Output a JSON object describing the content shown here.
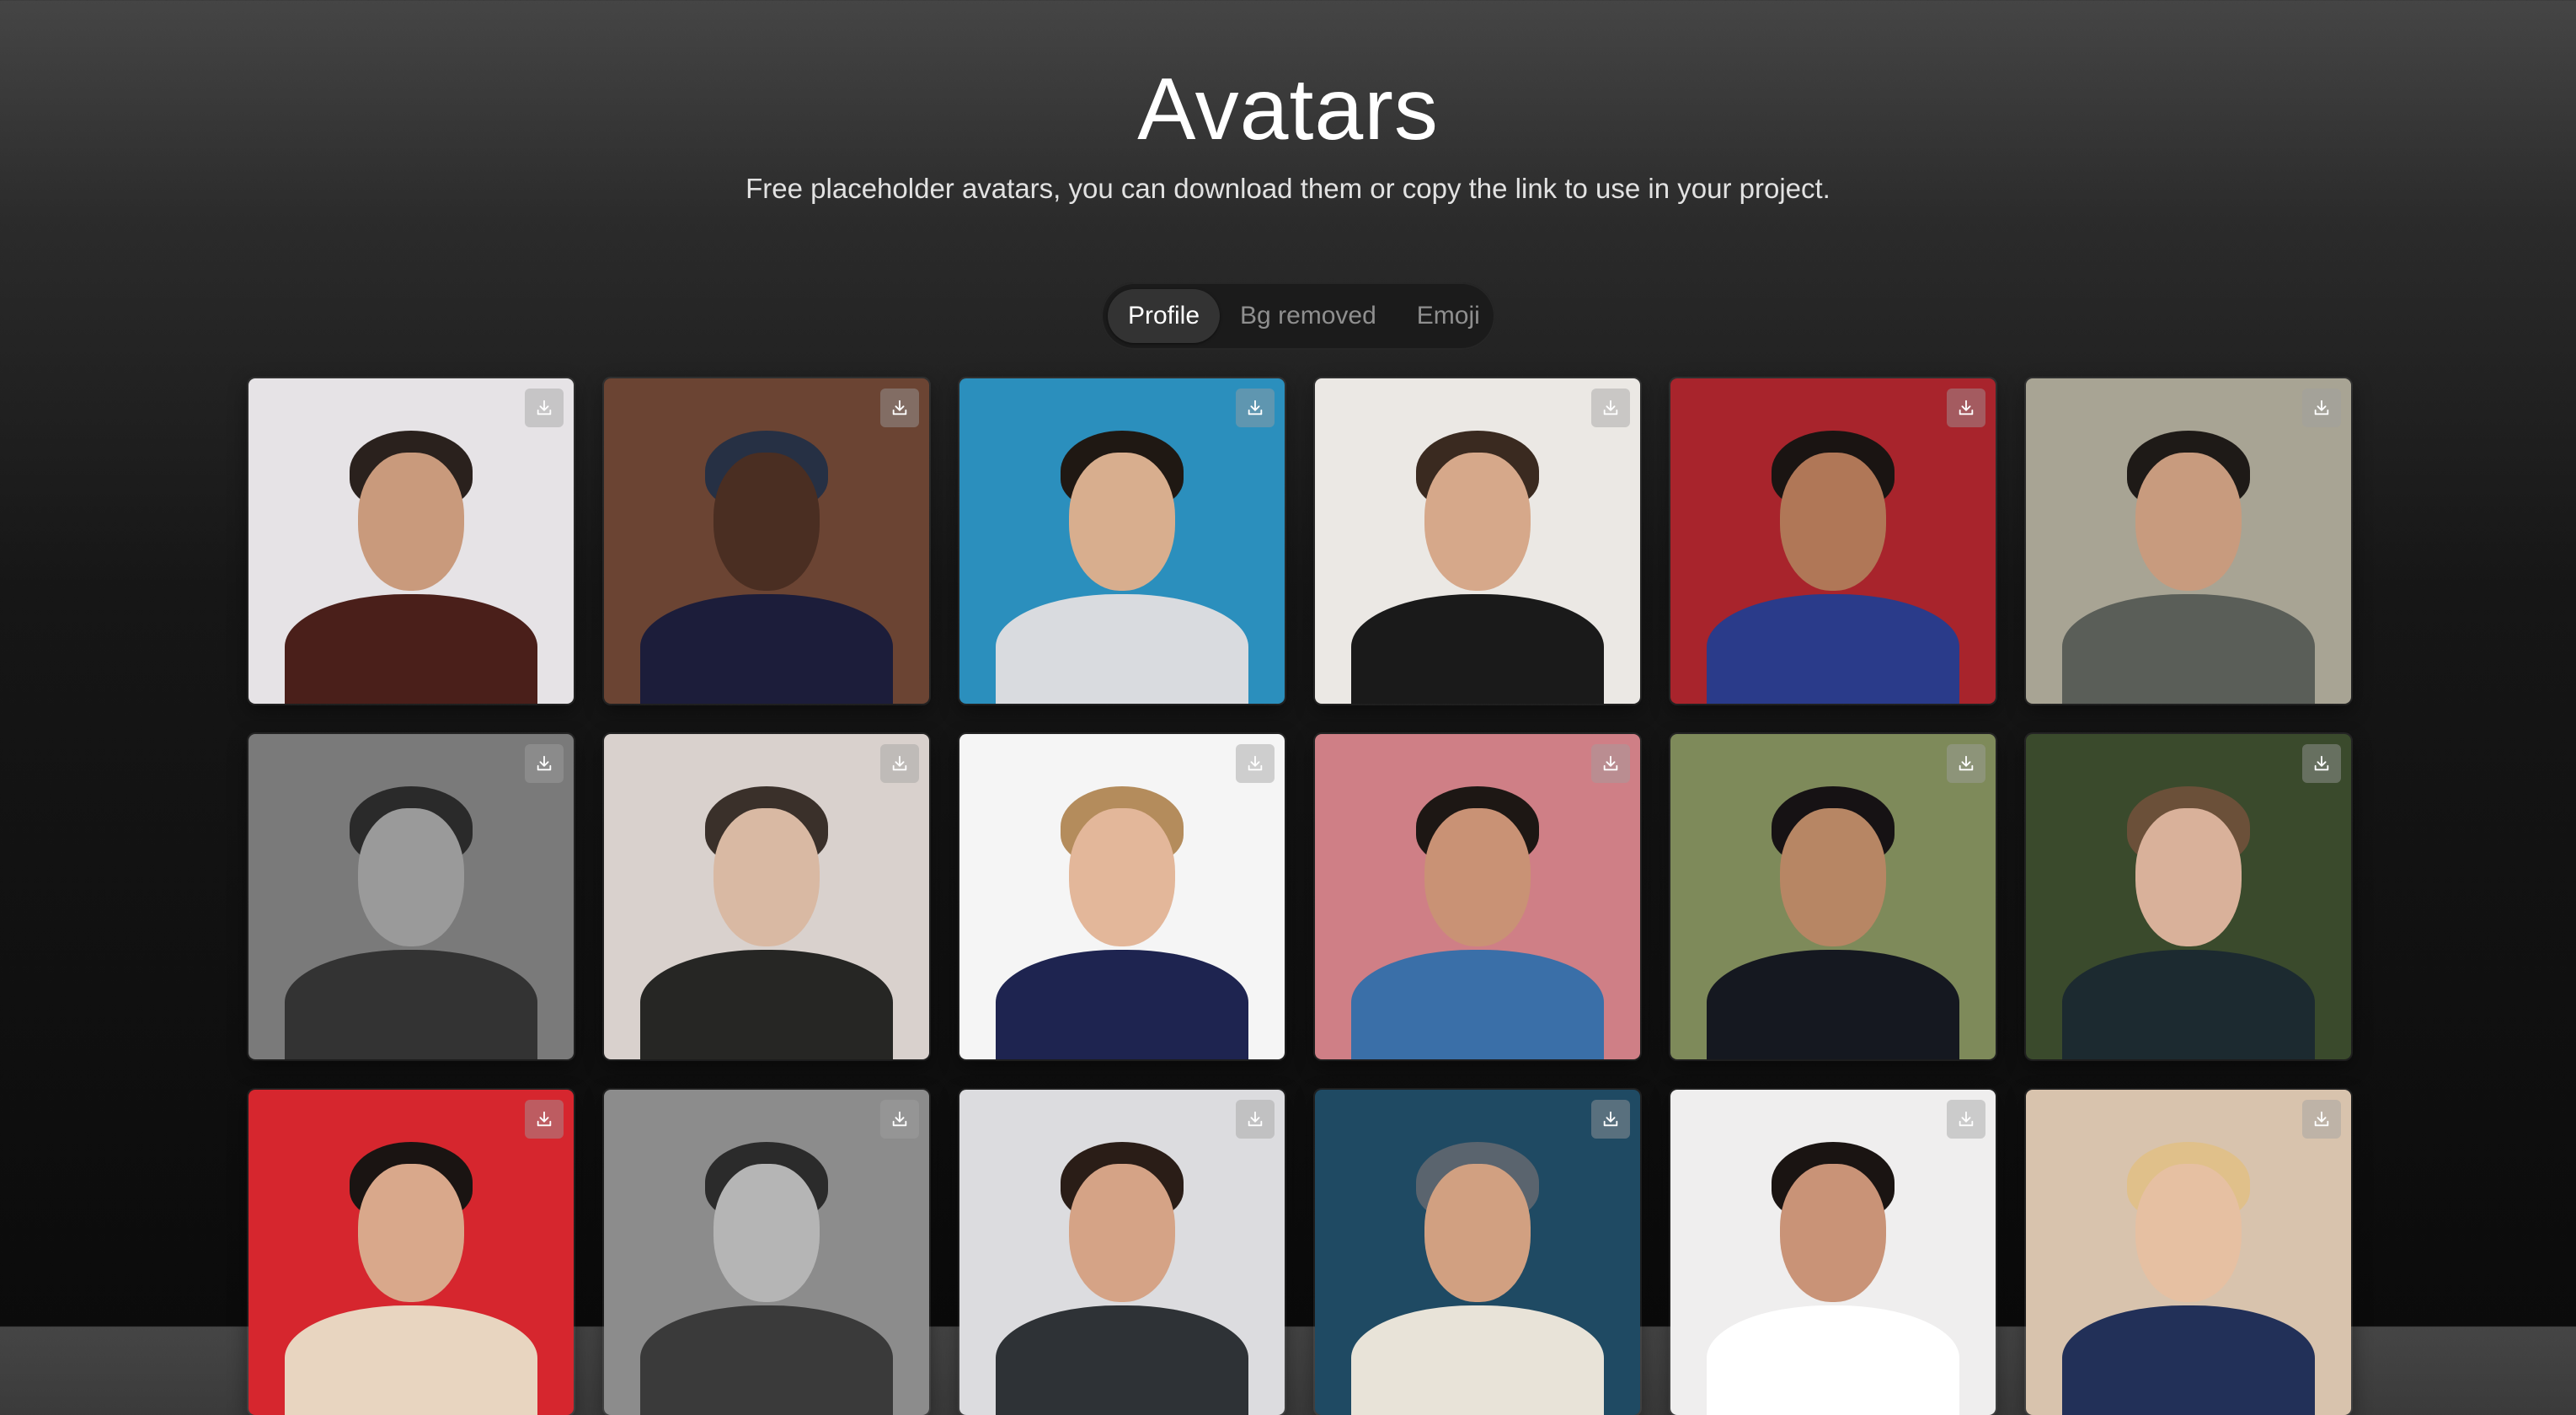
{
  "header": {
    "title": "Avatars",
    "subtitle": "Free placeholder avatars, you can download them or copy the link to use in your project."
  },
  "tabs": [
    {
      "label": "Profile",
      "active": true
    },
    {
      "label": "Bg removed",
      "active": false
    },
    {
      "label": "Emoji",
      "active": false
    }
  ],
  "download_icon": "download-icon",
  "avatars": [
    {
      "bg": "#e6e3e6",
      "skin": "#c99a7c",
      "hair": "#2a211d",
      "shirt": "#4a1f1a"
    },
    {
      "bg": "#6b4433",
      "skin": "#4a2e22",
      "hair": "#263044",
      "shirt": "#1c1d3a"
    },
    {
      "bg": "#2b8fbd",
      "skin": "#d8ae8e",
      "hair": "#1f1813",
      "shirt": "#d9dbdf"
    },
    {
      "bg": "#ebe8e4",
      "skin": "#d6a88a",
      "hair": "#3a2a20",
      "shirt": "#1a1a1a"
    },
    {
      "bg": "#a8242c",
      "skin": "#b07757",
      "hair": "#1a1412",
      "shirt": "#2a3b8a"
    },
    {
      "bg": "#a8a494",
      "skin": "#c89b7e",
      "hair": "#1e1a17",
      "shirt": "#5a5e58"
    },
    {
      "bg": "#7a7a7a",
      "skin": "#9a9a9a",
      "hair": "#2a2a2a",
      "shirt": "#333333"
    },
    {
      "bg": "#d9d1cd",
      "skin": "#d9b9a3",
      "hair": "#3a302a",
      "shirt": "#262624"
    },
    {
      "bg": "#f5f5f5",
      "skin": "#e3b79a",
      "hair": "#b48c5c",
      "shirt": "#1e2450"
    },
    {
      "bg": "#cf7f86",
      "skin": "#c99275",
      "hair": "#1d1714",
      "shirt": "#3a6fa8"
    },
    {
      "bg": "#7e8a5a",
      "skin": "#b78664",
      "hair": "#161214",
      "shirt": "#151820"
    },
    {
      "bg": "#3a4a2c",
      "skin": "#d9b19a",
      "hair": "#6b5039",
      "shirt": "#1c2a30"
    },
    {
      "bg": "#d6262e",
      "skin": "#d9a88b",
      "hair": "#1a1412",
      "shirt": "#e8d5c0"
    },
    {
      "bg": "#8c8c8c",
      "skin": "#b5b5b5",
      "hair": "#2b2b2b",
      "shirt": "#3a3a3a"
    },
    {
      "bg": "#dcdcdf",
      "skin": "#d5a386",
      "hair": "#2a1d17",
      "shirt": "#2e3236"
    },
    {
      "bg": "#1f4a63",
      "skin": "#d1a081",
      "hair": "#5a646e",
      "shirt": "#e8e3d8"
    },
    {
      "bg": "#efeeee",
      "skin": "#c99377",
      "hair": "#1a1412",
      "shirt": "#ffffff"
    },
    {
      "bg": "#d8c3ad",
      "skin": "#e6c0a2",
      "hair": "#e0c08a",
      "shirt": "#223058"
    }
  ]
}
